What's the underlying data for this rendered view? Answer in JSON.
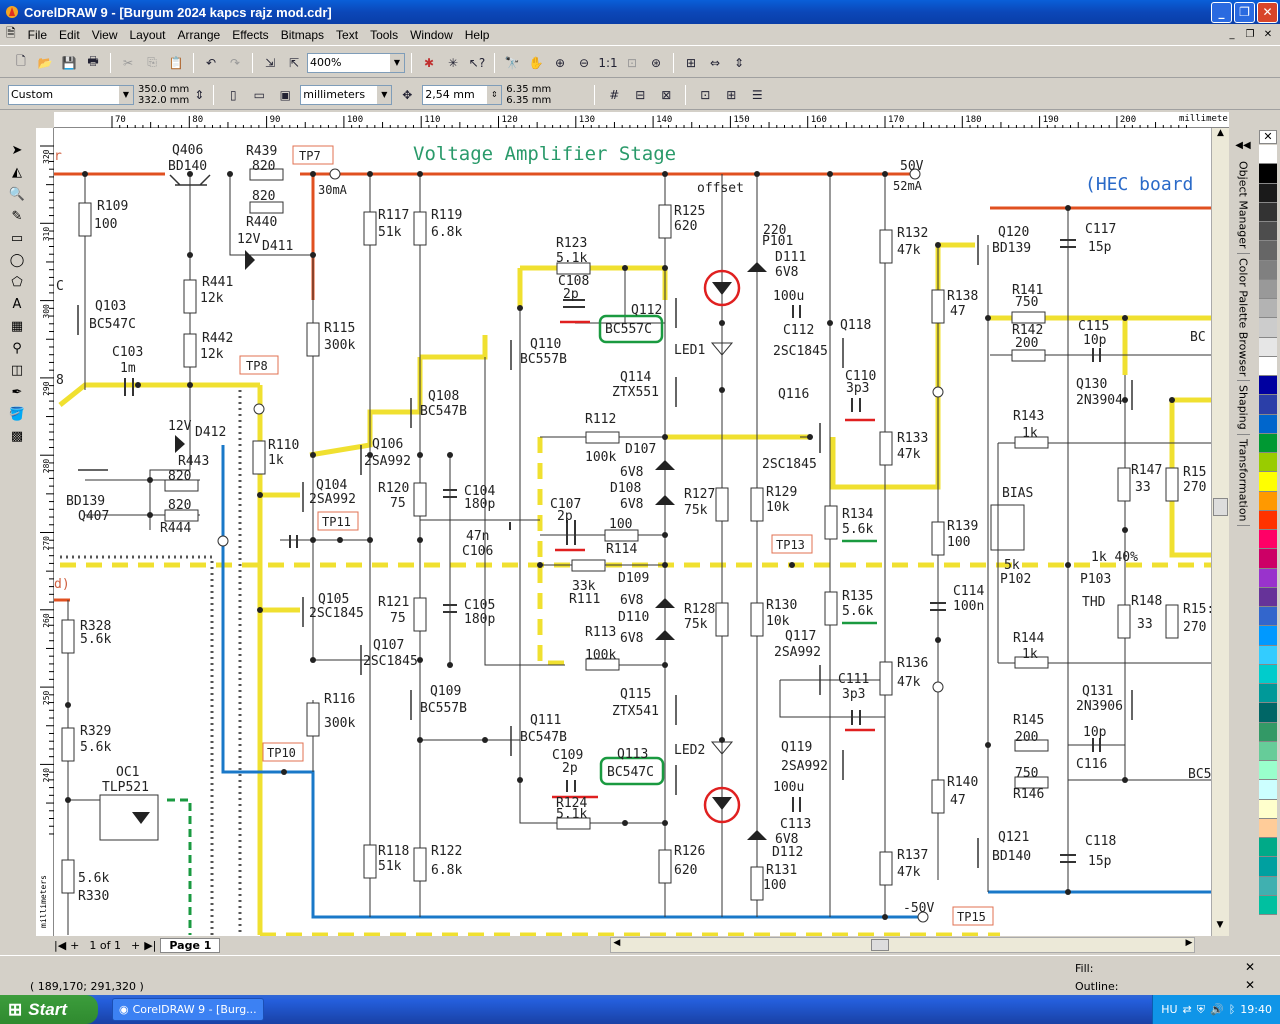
{
  "window": {
    "title": "CorelDRAW 9 - [Burgum 2024 kapcs rajz mod.cdr]"
  },
  "menu": [
    "File",
    "Edit",
    "View",
    "Layout",
    "Arrange",
    "Effects",
    "Bitmaps",
    "Text",
    "Tools",
    "Window",
    "Help"
  ],
  "toolbar": {
    "zoom": "400%"
  },
  "propbar": {
    "paper": "Custom",
    "width": "350.0 mm",
    "height": "332.0 mm",
    "units": "millimeters",
    "nudge": "2,54 mm",
    "dup_x": "6.35 mm",
    "dup_y": "6.35 mm"
  },
  "ruler": {
    "h_ticks": [
      "70",
      "80",
      "90",
      "100",
      "110",
      "120",
      "130",
      "140",
      "150",
      "160",
      "170",
      "180",
      "190",
      "200"
    ],
    "h_unit": "millimeters",
    "v_ticks": [
      "320",
      "310",
      "300",
      "290",
      "280",
      "270",
      "260",
      "250",
      "240"
    ],
    "v_unit": "millimeters"
  },
  "schematic": {
    "title": "Voltage Amplifier Stage",
    "hec": "(HEC board",
    "rail_pos": "50V",
    "rail_pos_current": "52mA",
    "rail_neg": "-50V",
    "tp7_current": "30mA",
    "testpoints": [
      "TP7",
      "TP8",
      "TP10",
      "TP11",
      "TP13",
      "TP15"
    ],
    "labels": {
      "q406": "Q406",
      "bd140a": "BD140",
      "r439": "R439",
      "r439v": "820",
      "r440v": "820",
      "r440": "R440",
      "r109": "R109",
      "r109v": "100",
      "d411v": "12V",
      "d411": "D411",
      "r441": "R441",
      "r441v": "12k",
      "r442": "R442",
      "r442v": "12k",
      "q103": "Q103",
      "bc547c_q103": "BC547C",
      "c103": "C103",
      "c103v": "1m",
      "r115": "R115",
      "r115v": "300k",
      "r117": "R117",
      "r117v": "51k",
      "r119": "R119",
      "r119v": "6.8k",
      "r123": "R123",
      "r123v": "5.1k",
      "c108": "C108",
      "c108v": "2p",
      "q112": "Q112",
      "q112t": "BC557C",
      "q110": "Q110",
      "q110t": "BC557B",
      "q108": "Q108",
      "q108t": "BC547B",
      "q106": "Q106",
      "q106t": "2SA992",
      "q104": "Q104",
      "q104t": "2SA992",
      "d412v": "12V",
      "d412": "D412",
      "r443": "R443",
      "r443v": "820",
      "r444v": "820",
      "r444": "R444",
      "bd139q": "BD139",
      "q407": "Q407",
      "r110": "R110",
      "r110v": "1k",
      "r120": "R120",
      "r120v": "75",
      "c104": "C104",
      "c104v": "180p",
      "c106v": "47n",
      "c106": "C106",
      "r112": "R112",
      "r112v": "100k",
      "c107": "C107",
      "c107v": "2p",
      "r114v": "100",
      "r114": "R114",
      "r111v": "33k",
      "r111": "R111",
      "q105": "Q105",
      "q105t": "2SC1845",
      "r121": "R121",
      "r121v": "75",
      "c105": "C105",
      "c105v": "180p",
      "q107": "Q107",
      "q107t": "2SC1845",
      "r113": "R113",
      "r113v": "100k",
      "r116": "R116",
      "r116v": "300k",
      "q109": "Q109",
      "q109t": "BC557B",
      "q111": "Q111",
      "q111t": "BC547B",
      "c109": "C109",
      "c109v": "2p",
      "r124": "R124",
      "r124v": "5.1k",
      "q113": "Q113",
      "q113t": "BC547C",
      "r118": "R118",
      "r118v": "51k",
      "r122": "R122",
      "r122v": "6.8k",
      "r126": "R126",
      "r126v": "620",
      "r125": "R125",
      "r125v": "620",
      "offset": "offset",
      "p101v": "220",
      "p101": "P101",
      "d111": "D111",
      "d111v": "6V8",
      "led1": "LED1",
      "led2": "LED2",
      "q114": "Q114",
      "q114t": "ZTX551",
      "q115": "Q115",
      "q115t": "ZTX541",
      "d107": "D107",
      "d107v": "6V8",
      "d108": "D108",
      "d108v": "6V8",
      "d109": "D109",
      "d109v": "6V8",
      "d110": "D110",
      "d110v": "6V8",
      "r127": "R127",
      "r127v": "75k",
      "r128": "R128",
      "r128v": "75k",
      "r129": "R129",
      "r129v": "10k",
      "r130": "R130",
      "r130v": "10k",
      "c112v": "100u",
      "c112": "C112",
      "c113v": "100u",
      "c113": "C113",
      "d112v": "6V8",
      "d112": "D112",
      "r131": "R131",
      "r131v": "100",
      "q118": "Q118",
      "q118t": "2SC1845",
      "q116": "Q116",
      "q116t": "2SC1845",
      "c110": "C110",
      "c110v": "3p3",
      "r133": "R133",
      "r133v": "47k",
      "r134": "R134",
      "r134v": "5.6k",
      "r135": "R135",
      "r135v": "5.6k",
      "q117": "Q117",
      "q117t": "2SA992",
      "c111": "C111",
      "c111v": "3p3",
      "q119": "Q119",
      "q119t": "2SA992",
      "r136": "R136",
      "r136v": "47k",
      "r137": "R137",
      "r137v": "47k",
      "r132": "R132",
      "r132v": "47k",
      "r138": "R138",
      "r138v": "47",
      "r139": "R139",
      "r139v": "100",
      "c114": "C114",
      "c114v": "100n",
      "r140": "R140",
      "r140v": "47",
      "q120": "Q120",
      "q120t": "BD139",
      "q121": "Q121",
      "q121t": "BD140",
      "c117": "C117",
      "c117v": "15p",
      "c118": "C118",
      "c118v": "15p",
      "r141": "R141",
      "r141v": "750",
      "r142v": "200",
      "r142": "R142",
      "c115": "C115",
      "c115v": "10p",
      "q130": "Q130",
      "q130t": "2N3904",
      "r143": "R143",
      "r143v": "1k",
      "bias": "BIAS",
      "p102v": "5k",
      "p102": "P102",
      "r147": "R147",
      "r147v": "33",
      "r15x": "R15",
      "r15xv": "270",
      "p103v": "1k 40%",
      "p103": "P103",
      "thd": "THD",
      "r148": "R148",
      "r148v": "33",
      "r15y": "R15:",
      "r15yv": "270",
      "r144": "R144",
      "r144v": "1k",
      "q131": "Q131",
      "q131t": "2N3906",
      "r145": "R145",
      "r145v": "200",
      "c116v": "10p",
      "c116": "C116",
      "r146v": "750",
      "r146": "R146",
      "bc_a": "BC",
      "bc_b": "BC5",
      "r328": "R328",
      "r328v": "5.6k",
      "r329": "R329",
      "r329v": "5.6k",
      "oc1": "OC1",
      "oc1t": "TLP521",
      "r330v": "5.6k",
      "r330": "R330",
      "left_c": "C",
      "left_8": "8",
      "left_r": "r",
      "left_d": "d)"
    }
  },
  "pagenav": {
    "pages": "1 of 1",
    "page": "Page 1"
  },
  "status": {
    "coords": "( 189,170; 291,320 )",
    "fill": "Fill:",
    "outline": "Outline:"
  },
  "taskbar": {
    "start": "Start",
    "task": "CorelDRAW 9 - [Burg...",
    "lang": "HU",
    "time": "19:40"
  },
  "dockers": [
    "Object Manager",
    "Color Palette Browser",
    "Shaping",
    "Transformation"
  ],
  "palette": [
    "#ffffff",
    "#000000",
    "#1a1a1a",
    "#333333",
    "#4d4d4d",
    "#666666",
    "#808080",
    "#999999",
    "#b3b3b3",
    "#cccccc",
    "#e6e6e6",
    "#ffffff",
    "#0000a0",
    "#2b3fa8",
    "#0066cc",
    "#009933",
    "#99cc00",
    "#ffff00",
    "#ff9900",
    "#ff3300",
    "#ff0066",
    "#cc0066",
    "#9933cc",
    "#663399",
    "#3366cc",
    "#0099ff",
    "#33ccff",
    "#00cccc",
    "#009999",
    "#006666",
    "#339966",
    "#66cc99",
    "#99ffcc",
    "#ccffff",
    "#ffffcc",
    "#ffcc99",
    "#00aa88",
    "#00a0a0",
    "#40b0b0",
    "#00c0a0"
  ]
}
